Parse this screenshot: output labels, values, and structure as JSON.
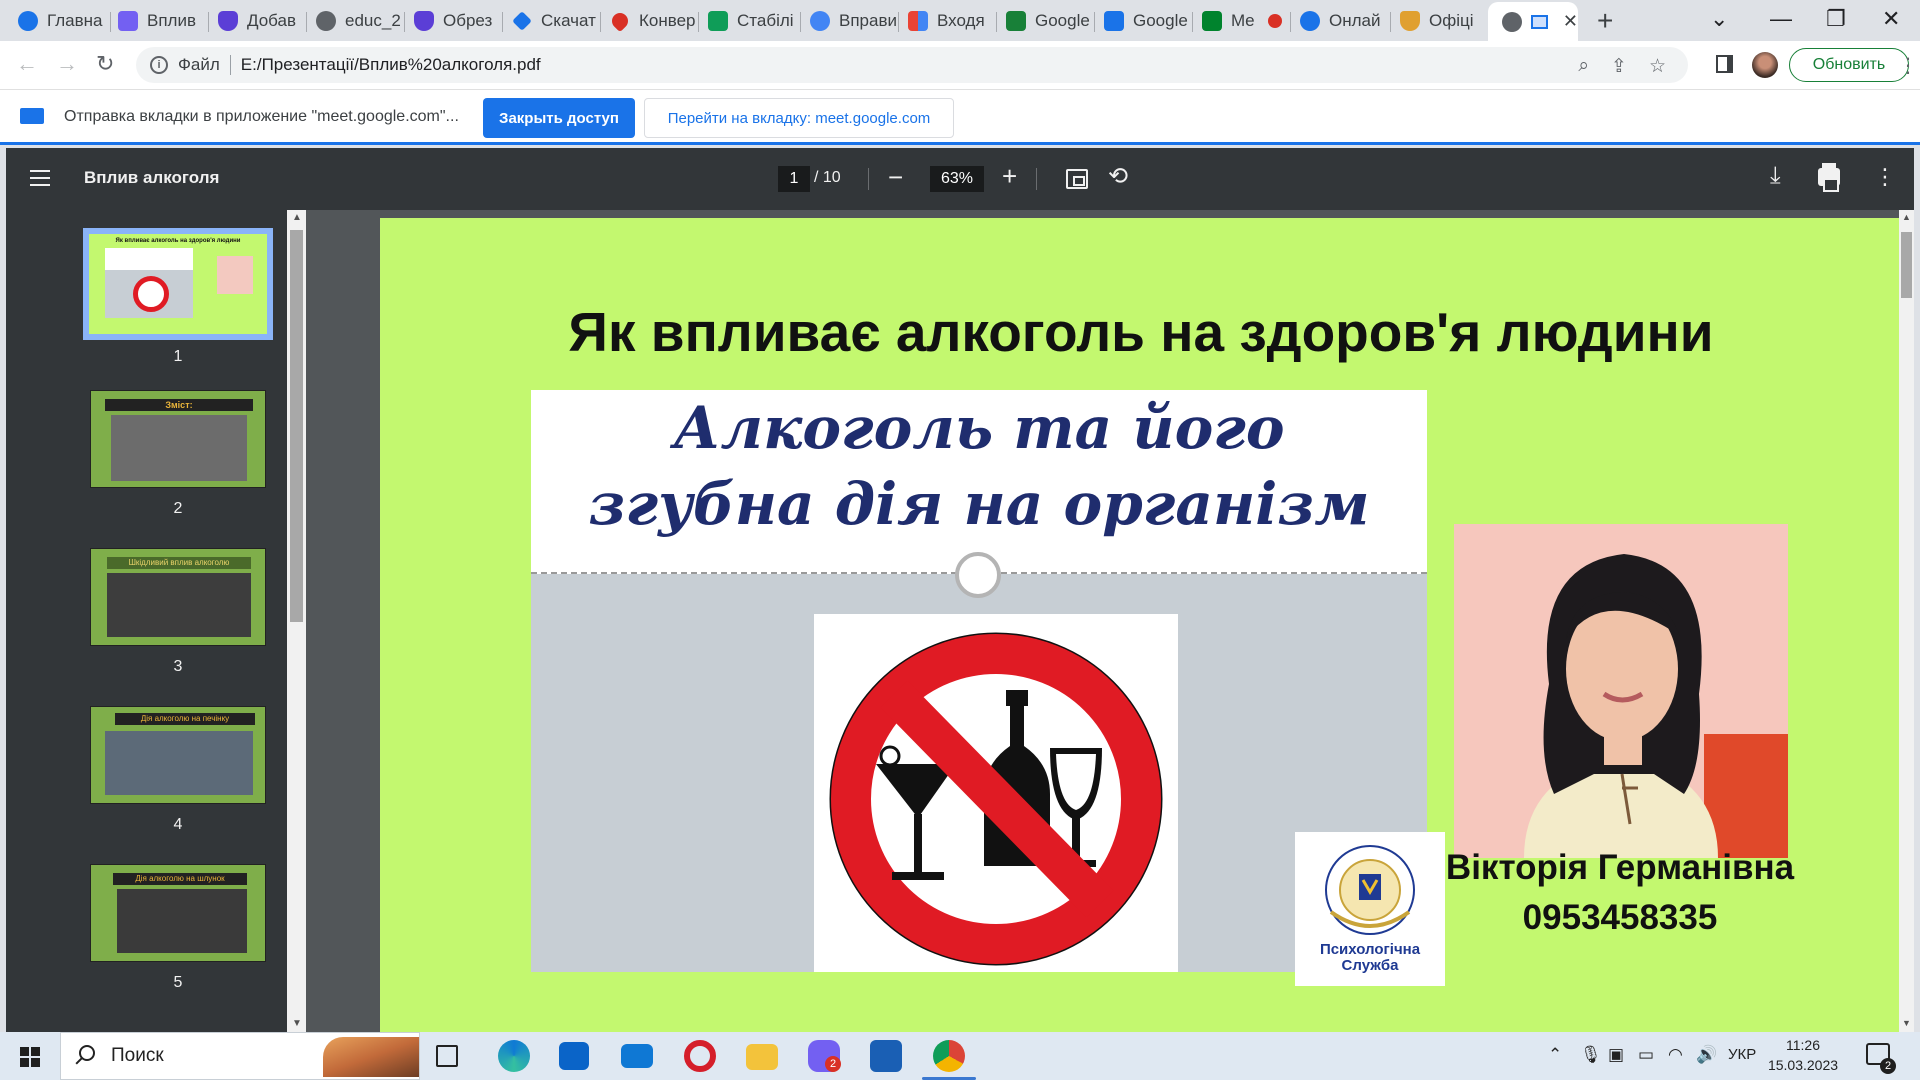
{
  "browser": {
    "tabs": [
      {
        "label": "Главна",
        "icon": "browser-icon",
        "color": "#1a73e8"
      },
      {
        "label": "Вплив",
        "icon": "viber-icon",
        "color": "#7360f2"
      },
      {
        "label": "Добав",
        "icon": "shield-icon",
        "color": "#5b3ed6"
      },
      {
        "label": "educ_2",
        "icon": "globe-icon",
        "color": "#5f6368"
      },
      {
        "label": "Обрез",
        "icon": "shield-icon",
        "color": "#5b3ed6"
      },
      {
        "label": "Скачат",
        "icon": "download-icon",
        "color": "#1a73e8"
      },
      {
        "label": "Конвер",
        "icon": "heart-icon",
        "color": "#d93025"
      },
      {
        "label": "Стабілі",
        "icon": "sheets-icon",
        "color": "#0f9d58"
      },
      {
        "label": "Вправи",
        "icon": "compass-icon",
        "color": "#4285f4"
      },
      {
        "label": "Входя",
        "icon": "gmail-icon",
        "color": "#ea4335"
      },
      {
        "label": "Google",
        "icon": "classroom-icon",
        "color": "#188038"
      },
      {
        "label": "Google",
        "icon": "calendar-icon",
        "color": "#1a73e8"
      },
      {
        "label": "Me",
        "icon": "meet-icon",
        "color": "#00832d"
      },
      {
        "label": "Онлай",
        "icon": "camera-icon",
        "color": "#1a73e8"
      },
      {
        "label": "Офіці",
        "icon": "emblem-icon",
        "color": "#e0a030"
      },
      {
        "label": "",
        "icon": "globe-icon",
        "color": "#5f6368",
        "active": true
      }
    ],
    "new_tab": "+",
    "address": {
      "scheme": "Файл",
      "url": "E:/Презентації/Вплив%20алкоголя.pdf"
    },
    "update_button": "Обновить"
  },
  "infobar": {
    "message": "Отправка вкладки в приложение \"meet.google.com\"...",
    "primary_button": "Закрыть доступ",
    "secondary_button": "Перейти на вкладку: meet.google.com"
  },
  "pdf": {
    "title": "Вплив алкоголя",
    "page_current": "1",
    "page_total": "/ 10",
    "zoom": "63%",
    "thumbnails": [
      {
        "num": "1",
        "header": "Як впливає алкоголь на здоров'я людини",
        "bg": "#c3f86f",
        "selected": true
      },
      {
        "num": "2",
        "header": "Зміст:",
        "bg": "#7fae4a"
      },
      {
        "num": "3",
        "header": "Шкідливий вплив алкоголю",
        "bg": "#7fae4a"
      },
      {
        "num": "4",
        "header": "Дія алкоголю на печінку",
        "bg": "#7fae4a"
      },
      {
        "num": "5",
        "header": "Дія алкоголю на шлунок",
        "bg": "#7fae4a"
      }
    ]
  },
  "slide": {
    "title": "Як впливає алкоголь на здоров'я людини",
    "banner_line1": "Алкоголь та його",
    "banner_line2": "згубна дія на організм",
    "person_name": "Вікторія Германівна",
    "person_phone": "0953458335",
    "logo_caption_1": "Психологічна",
    "logo_caption_2": "Служба",
    "colors": {
      "background": "#c3f86f",
      "banner_text": "#1f2d6e",
      "sign_red": "#e01b24"
    }
  },
  "taskbar": {
    "search_placeholder": "Поиск",
    "language": "УКР",
    "time": "11:26",
    "date": "15.03.2023",
    "notification_count": "2",
    "viber_badge": "2",
    "apps": [
      "task-view-icon",
      "edge-icon",
      "store-icon",
      "mail-icon",
      "opera-icon",
      "explorer-icon",
      "viber-icon",
      "photos-icon",
      "chrome-icon"
    ]
  }
}
